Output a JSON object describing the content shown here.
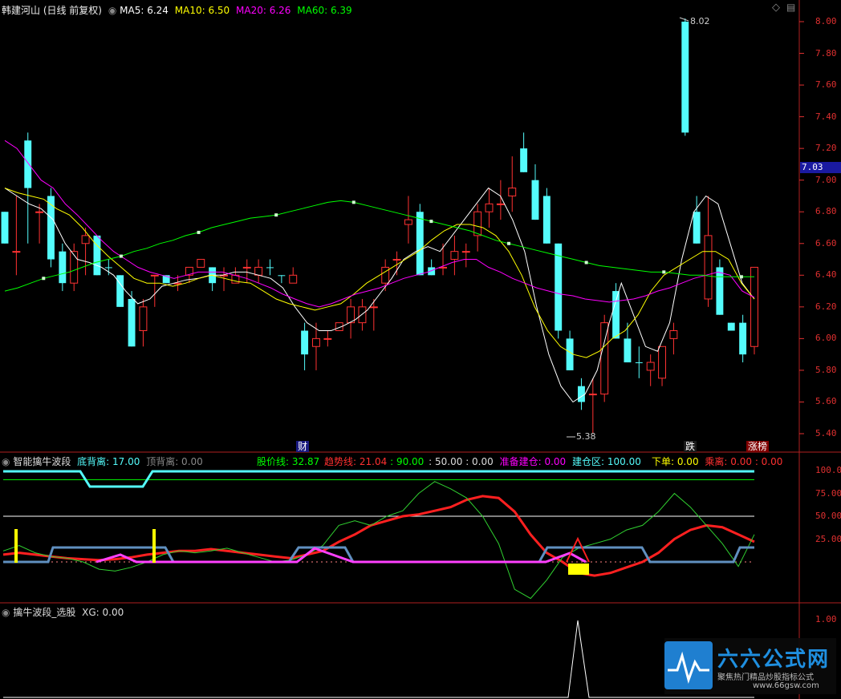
{
  "main_panel": {
    "title": "韩建河山 (日线 前复权)",
    "ma5_label": "MA5: 6.24",
    "ma10_label": "MA10: 6.50",
    "ma20_label": "MA20: 6.26",
    "ma60_label": "MA60: 6.39",
    "axis_ticks": [
      "8.00",
      "7.80",
      "7.60",
      "7.40",
      "7.20",
      "7.00",
      "6.80",
      "6.60",
      "6.40",
      "6.20",
      "6.00",
      "5.80",
      "5.60",
      "5.40"
    ],
    "current_price": "7.03",
    "high_label": "8.02",
    "low_label": "5.38",
    "badge_cai": "财",
    "badge_die": "跌",
    "badge_zhangting": "涨榜"
  },
  "panel2": {
    "title": "智能擒牛波段",
    "dibeili": "底背离: 17.00",
    "dingbeili": "顶背离: 0.00",
    "gujiaxian": "股价线: 32.87",
    "qushixian": "趋势线: 21.04",
    "v90": ": 90.00",
    "v50": ": 50.00",
    "v0": ": 0.00",
    "zhunbei": "准备建仓: 0.00",
    "jiancang": "建仓区: 100.00",
    "xiadan": "下单: 0.00",
    "chengli": "乘离: 0.00",
    "v00": ": 0.00",
    "axis_ticks": [
      "100.0",
      "75.00",
      "50.00",
      "25.00"
    ]
  },
  "panel3": {
    "title": "擒牛波段_选股",
    "xg": "XG: 0.00",
    "axis_ticks": [
      "1.00"
    ]
  },
  "watermark": {
    "title": "六六公式网",
    "sub": "聚焦热门精品炒股指标公式",
    "url": "www.66gsw.com"
  },
  "colors": {
    "up": "#ff3232",
    "down": "#54fcfc",
    "ma5": "#ffffff",
    "ma10": "#ffff00",
    "ma20": "#ff00ff",
    "ma60": "#00ff00",
    "axis": "#e03030"
  },
  "chart_data": {
    "type": "candlestick",
    "y_range": [
      5.3,
      8.1
    ],
    "candles": [
      [
        6.6,
        6.8,
        6.6,
        6.8,
        "d"
      ],
      [
        6.55,
        6.9,
        6.4,
        6.55,
        "u"
      ],
      [
        7.25,
        7.3,
        6.6,
        6.95,
        "d"
      ],
      [
        6.8,
        6.85,
        6.6,
        6.8,
        "u"
      ],
      [
        6.9,
        6.95,
        6.45,
        6.5,
        "d"
      ],
      [
        6.55,
        6.6,
        6.3,
        6.35,
        "d"
      ],
      [
        6.35,
        6.6,
        6.3,
        6.55,
        "u"
      ],
      [
        6.6,
        6.7,
        6.4,
        6.65,
        "u"
      ],
      [
        6.65,
        6.65,
        6.4,
        6.4,
        "d"
      ],
      [
        6.45,
        6.5,
        6.4,
        6.45,
        "d"
      ],
      [
        6.4,
        6.4,
        6.2,
        6.2,
        "d"
      ],
      [
        6.25,
        6.3,
        5.95,
        5.95,
        "d"
      ],
      [
        6.05,
        6.25,
        5.95,
        6.2,
        "u"
      ],
      [
        6.4,
        6.4,
        6.2,
        6.4,
        "u"
      ],
      [
        6.4,
        6.4,
        6.35,
        6.35,
        "d"
      ],
      [
        6.35,
        6.4,
        6.3,
        6.35,
        "u"
      ],
      [
        6.4,
        6.45,
        6.35,
        6.45,
        "u"
      ],
      [
        6.45,
        6.5,
        6.45,
        6.5,
        "u"
      ],
      [
        6.45,
        6.45,
        6.3,
        6.35,
        "d"
      ],
      [
        6.4,
        6.45,
        6.3,
        6.4,
        "u"
      ],
      [
        6.35,
        6.45,
        6.35,
        6.4,
        "u"
      ],
      [
        6.45,
        6.5,
        6.35,
        6.45,
        "u"
      ],
      [
        6.45,
        6.5,
        6.35,
        6.4,
        "u"
      ],
      [
        6.45,
        6.5,
        6.4,
        6.45,
        "d"
      ],
      [
        6.4,
        6.4,
        6.35,
        6.4,
        "d"
      ],
      [
        6.4,
        6.45,
        6.35,
        6.35,
        "u"
      ],
      [
        6.05,
        6.1,
        5.8,
        5.9,
        "d"
      ],
      [
        5.95,
        6.1,
        5.8,
        6.0,
        "u"
      ],
      [
        6.0,
        6.05,
        5.95,
        6.0,
        "u"
      ],
      [
        6.05,
        6.1,
        6.05,
        6.1,
        "u"
      ],
      [
        6.1,
        6.25,
        6.0,
        6.2,
        "u"
      ],
      [
        6.2,
        6.25,
        6.05,
        6.1,
        "u"
      ],
      [
        6.2,
        6.25,
        6.05,
        6.2,
        "u"
      ],
      [
        6.35,
        6.5,
        6.3,
        6.45,
        "u"
      ],
      [
        6.5,
        6.55,
        6.4,
        6.5,
        "u"
      ],
      [
        6.72,
        6.9,
        6.6,
        6.75,
        "u"
      ],
      [
        6.8,
        6.85,
        6.4,
        6.4,
        "d"
      ],
      [
        6.45,
        6.5,
        6.4,
        6.4,
        "d"
      ],
      [
        6.45,
        6.6,
        6.4,
        6.45,
        "u"
      ],
      [
        6.55,
        6.65,
        6.4,
        6.5,
        "u"
      ],
      [
        6.55,
        6.6,
        6.45,
        6.55,
        "u"
      ],
      [
        6.65,
        6.85,
        6.55,
        6.8,
        "u"
      ],
      [
        6.8,
        6.95,
        6.7,
        6.85,
        "u"
      ],
      [
        6.85,
        7.0,
        6.75,
        6.85,
        "u"
      ],
      [
        6.9,
        7.15,
        6.8,
        6.95,
        "u"
      ],
      [
        7.2,
        7.3,
        7.05,
        7.05,
        "d"
      ],
      [
        7.0,
        7.1,
        6.75,
        6.75,
        "d"
      ],
      [
        6.9,
        6.95,
        6.6,
        6.6,
        "d"
      ],
      [
        6.6,
        6.6,
        6.0,
        6.05,
        "d"
      ],
      [
        6.0,
        6.05,
        5.8,
        5.8,
        "d"
      ],
      [
        5.6,
        5.75,
        5.55,
        5.7,
        "d"
      ],
      [
        5.65,
        5.75,
        5.4,
        5.65,
        "u"
      ],
      [
        5.65,
        6.15,
        5.6,
        6.1,
        "u"
      ],
      [
        6.3,
        6.35,
        6.0,
        6.0,
        "d"
      ],
      [
        6.0,
        6.1,
        5.85,
        5.85,
        "d"
      ],
      [
        5.85,
        5.95,
        5.75,
        5.85,
        "d"
      ],
      [
        5.8,
        5.9,
        5.7,
        5.85,
        "u"
      ],
      [
        5.75,
        5.95,
        5.7,
        5.95,
        "u"
      ],
      [
        6.05,
        6.1,
        5.9,
        6.0,
        "u"
      ],
      [
        8.0,
        8.02,
        7.28,
        7.3,
        "d"
      ],
      [
        6.8,
        6.9,
        6.6,
        6.6,
        "d"
      ],
      [
        6.25,
        6.9,
        6.2,
        6.65,
        "u"
      ],
      [
        6.45,
        6.5,
        6.15,
        6.15,
        "d"
      ],
      [
        6.1,
        6.1,
        6.05,
        6.05,
        "d"
      ],
      [
        6.1,
        6.15,
        5.85,
        5.9,
        "d"
      ],
      [
        5.95,
        6.45,
        5.9,
        6.45,
        "u"
      ]
    ],
    "ma_series": {
      "ma5": [
        6.95,
        6.9,
        6.85,
        6.82,
        6.75,
        6.6,
        6.5,
        6.48,
        6.45,
        6.4,
        6.3,
        6.22,
        6.25,
        6.33,
        6.35,
        6.37,
        6.38,
        6.4,
        6.4,
        6.42,
        6.42,
        6.4,
        6.38,
        6.32,
        6.2,
        6.1,
        6.05,
        6.05,
        6.08,
        6.12,
        6.18,
        6.28,
        6.38,
        6.5,
        6.55,
        6.58,
        6.55,
        6.65,
        6.75,
        6.85,
        6.95,
        6.9,
        6.75,
        6.55,
        6.2,
        5.9,
        5.7,
        5.6,
        5.65,
        5.8,
        6.1,
        6.35,
        6.15,
        5.95,
        5.92,
        6.1,
        6.5,
        6.8,
        6.9,
        6.85,
        6.6,
        6.35,
        6.25
      ],
      "ma10": [
        6.95,
        6.92,
        6.9,
        6.88,
        6.82,
        6.78,
        6.7,
        6.6,
        6.52,
        6.45,
        6.38,
        6.35,
        6.35,
        6.33,
        6.35,
        6.38,
        6.4,
        6.38,
        6.36,
        6.35,
        6.3,
        6.25,
        6.22,
        6.2,
        6.18,
        6.2,
        6.22,
        6.28,
        6.35,
        6.4,
        6.45,
        6.5,
        6.55,
        6.62,
        6.68,
        6.72,
        6.72,
        6.7,
        6.65,
        6.55,
        6.4,
        6.2,
        6.05,
        5.95,
        5.9,
        5.88,
        5.92,
        6.0,
        6.05,
        6.15,
        6.3,
        6.4,
        6.45,
        6.5,
        6.55,
        6.55,
        6.5,
        6.35,
        6.25
      ],
      "ma20": [
        7.25,
        7.2,
        7.1,
        7.0,
        6.95,
        6.85,
        6.78,
        6.7,
        6.62,
        6.55,
        6.5,
        6.45,
        6.42,
        6.4,
        6.38,
        6.4,
        6.42,
        6.42,
        6.42,
        6.4,
        6.38,
        6.35,
        6.32,
        6.28,
        6.25,
        6.22,
        6.2,
        6.22,
        6.25,
        6.28,
        6.3,
        6.32,
        6.35,
        6.38,
        6.4,
        6.42,
        6.45,
        6.48,
        6.5,
        6.5,
        6.45,
        6.42,
        6.38,
        6.35,
        6.32,
        6.3,
        6.28,
        6.27,
        6.25,
        6.24,
        6.23,
        6.24,
        6.25,
        6.27,
        6.3,
        6.32,
        6.35,
        6.38,
        6.4,
        6.42,
        6.4,
        6.3,
        6.26
      ],
      "ma60": [
        6.3,
        6.32,
        6.35,
        6.38,
        6.4,
        6.42,
        6.45,
        6.48,
        6.5,
        6.52,
        6.55,
        6.57,
        6.6,
        6.62,
        6.65,
        6.67,
        6.7,
        6.72,
        6.74,
        6.76,
        6.77,
        6.78,
        6.8,
        6.82,
        6.84,
        6.86,
        6.87,
        6.86,
        6.84,
        6.82,
        6.8,
        6.78,
        6.76,
        6.74,
        6.72,
        6.7,
        6.68,
        6.65,
        6.62,
        6.6,
        6.58,
        6.56,
        6.54,
        6.52,
        6.5,
        6.48,
        6.46,
        6.45,
        6.44,
        6.43,
        6.42,
        6.42,
        6.41,
        6.4,
        6.4,
        6.39,
        6.39,
        6.39,
        6.39
      ]
    }
  }
}
